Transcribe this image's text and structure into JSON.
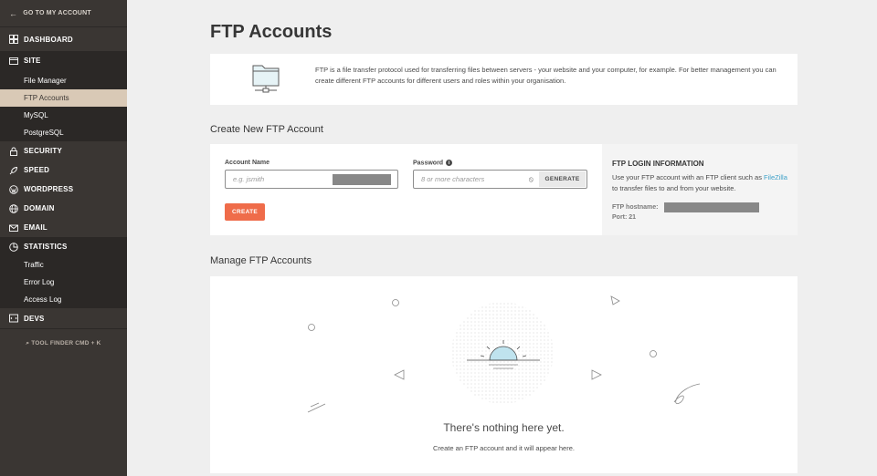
{
  "sidebar": {
    "back_label": "GO TO MY ACCOUNT",
    "dashboard": "DASHBOARD",
    "site": "SITE",
    "site_items": [
      "File Manager",
      "FTP Accounts",
      "MySQL",
      "PostgreSQL"
    ],
    "security": "SECURITY",
    "speed": "SPEED",
    "wordpress": "WORDPRESS",
    "domain": "DOMAIN",
    "email": "EMAIL",
    "statistics": "STATISTICS",
    "stat_items": [
      "Traffic",
      "Error Log",
      "Access Log"
    ],
    "devs": "DEVS",
    "tool_finder": "TOOL FINDER CMD + K"
  },
  "page": {
    "title": "FTP Accounts",
    "intro": "FTP is a file transfer protocol used for transferring files between servers - your website and your computer, for example. For better management you can create different FTP accounts for different users and roles within your organisation."
  },
  "create": {
    "section_title": "Create New FTP Account",
    "account_label": "Account Name",
    "account_placeholder": "e.g. jsmith",
    "password_label": "Password",
    "password_placeholder": "8 or more characters",
    "generate_label": "GENERATE",
    "create_label": "CREATE"
  },
  "login_info": {
    "title": "FTP LOGIN INFORMATION",
    "text_before": "Use your FTP account with an FTP client such as ",
    "link": "FileZilla",
    "text_after": " to transfer files to and from your website.",
    "host_label": "FTP hostname:",
    "port_label": "Port: 21"
  },
  "manage": {
    "section_title": "Manage FTP Accounts",
    "empty_title": "There's nothing here yet.",
    "empty_sub": "Create an FTP account and it will appear here."
  },
  "colors": {
    "sidebar_bg": "#3a3633",
    "active_item": "#d9c9b6",
    "create_button": "#ef6c4a",
    "link": "#3ea1c9"
  }
}
